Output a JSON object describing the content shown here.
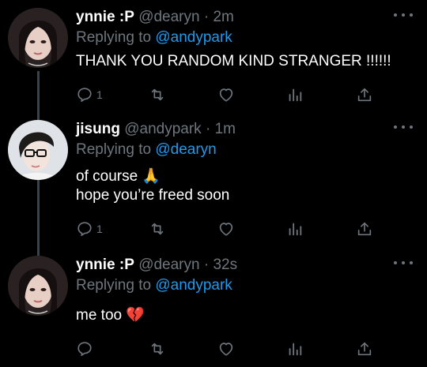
{
  "tweets": [
    {
      "name": "ynnie :P",
      "handle": "@dearyn",
      "separator": "·",
      "time": "2m",
      "replying_prefix": "Replying to",
      "replying_to": "@andypark",
      "lines": [
        "THANK YOU RANDOM KIND STRANGER !!!!!!"
      ],
      "reply_count": "1"
    },
    {
      "name": "jisung",
      "handle": "@andypark",
      "separator": "·",
      "time": "1m",
      "replying_prefix": "Replying to",
      "replying_to": "@dearyn",
      "lines": [
        "of course 🙏",
        "hope you’re freed soon"
      ],
      "reply_count": "1"
    },
    {
      "name": "ynnie :P",
      "handle": "@dearyn",
      "separator": "·",
      "time": "32s",
      "replying_prefix": "Replying to",
      "replying_to": "@andypark",
      "lines": [
        "me too 💔"
      ],
      "reply_count": ""
    }
  ],
  "colors": {
    "background": "#000000",
    "text": "#ffffff",
    "muted": "#6e767d",
    "link": "#1d9bf0",
    "thread_line": "#38444d"
  },
  "icons": [
    "reply-icon",
    "retweet-icon",
    "like-icon",
    "analytics-icon",
    "share-icon",
    "more-icon"
  ]
}
